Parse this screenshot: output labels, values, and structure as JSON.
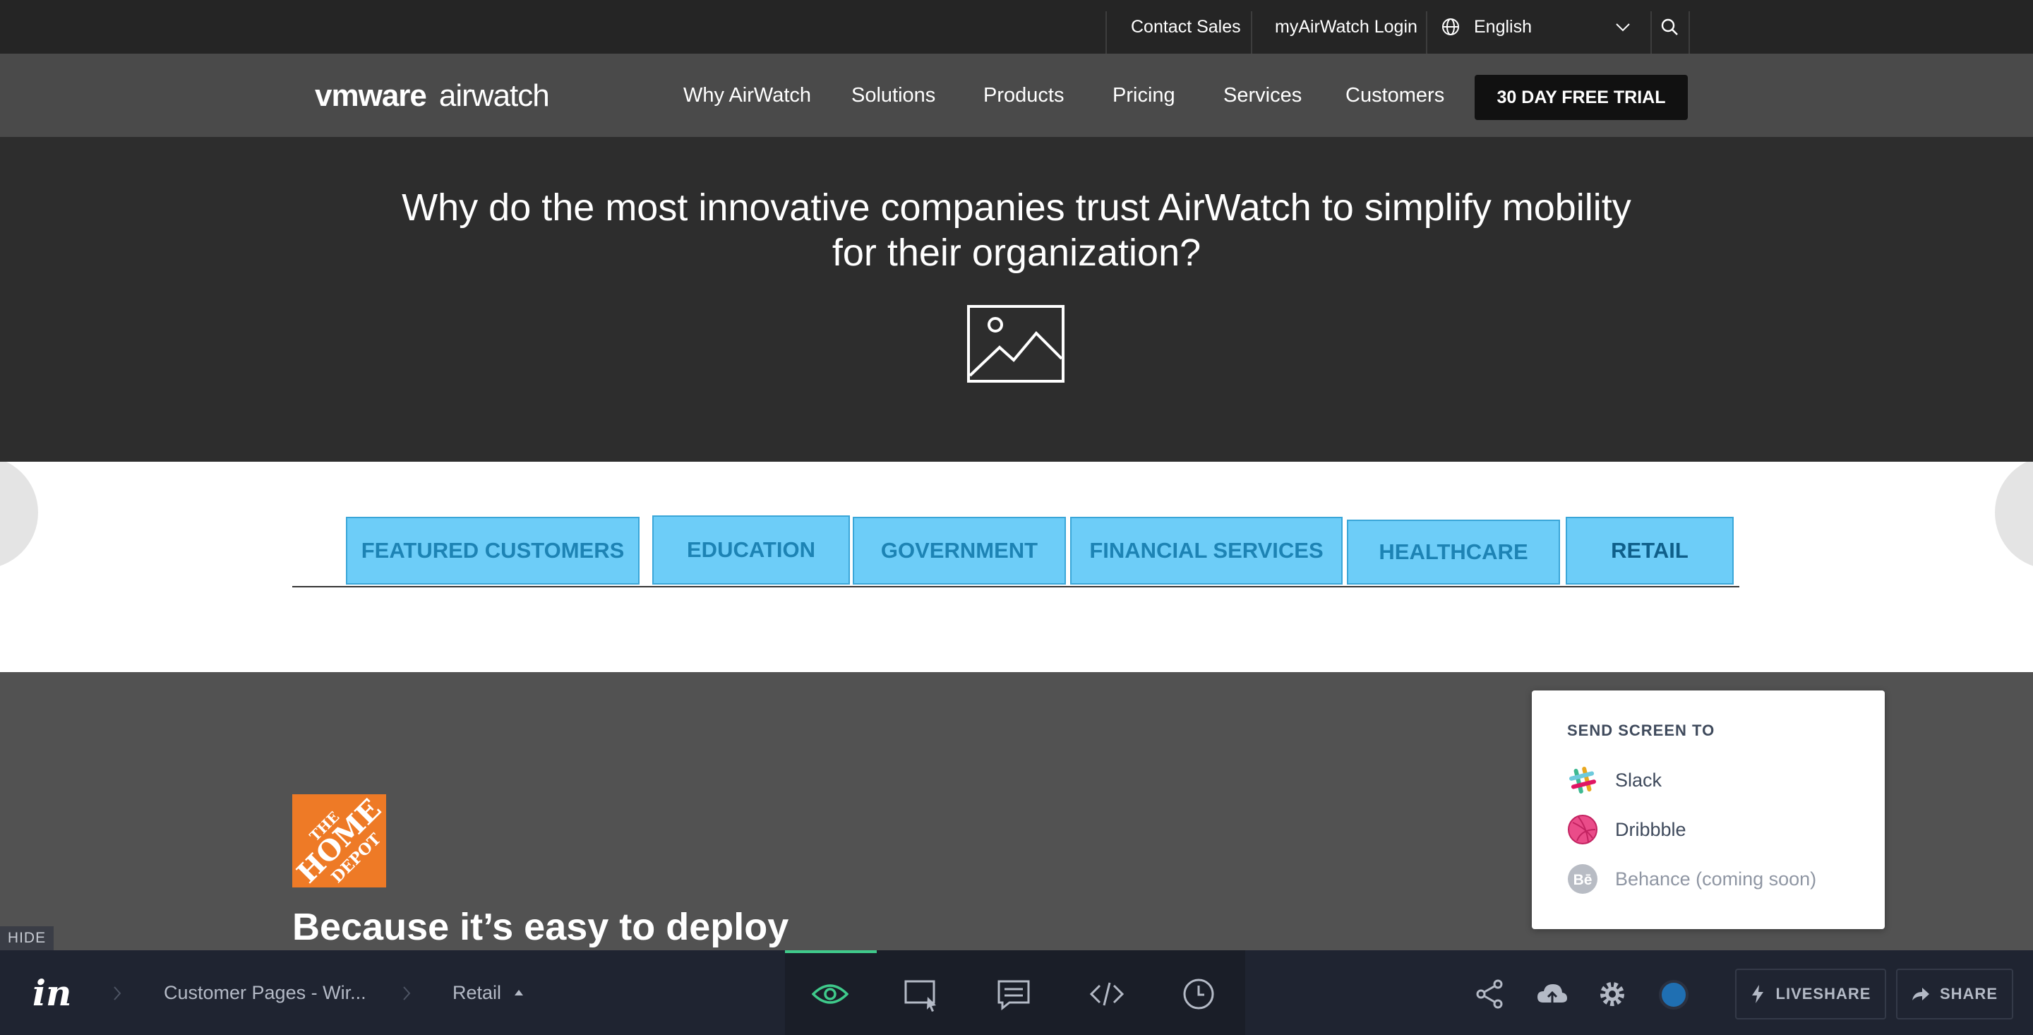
{
  "topbar": {
    "contact_sales": "Contact Sales",
    "login": "myAirWatch Login",
    "language": "English",
    "icons": [
      "globe-icon",
      "chevron-down-icon",
      "search-icon"
    ]
  },
  "navbar": {
    "logo_vm": "vmware",
    "logo_aw": "airwatch",
    "links": [
      "Why AirWatch",
      "Solutions",
      "Products",
      "Pricing",
      "Services",
      "Customers"
    ],
    "cta": "30 DAY FREE TRIAL"
  },
  "hero": {
    "title": "Why do the most innovative companies trust AirWatch to simplify mobility for their organization?",
    "image_icon": "image-placeholder-icon"
  },
  "tabs": [
    "FEATURED CUSTOMERS",
    "EDUCATION",
    "GOVERNMENT",
    "FINANCIAL SERVICES",
    "HEALTHCARE",
    "RETAIL"
  ],
  "customer": {
    "logo_text": "THE HOME DEPOT",
    "headline": "Because it’s easy to deploy"
  },
  "hide_label": "HIDE",
  "send_popup": {
    "title": "SEND SCREEN TO",
    "items": [
      "Slack",
      "Dribbble",
      "Behance (coming soon)"
    ]
  },
  "toolbar": {
    "project": "Customer Pages - Wir...",
    "screen": "Retail",
    "liveshare": "LIVESHARE",
    "share": "SHARE",
    "tools": [
      "preview-icon",
      "inspect-icon",
      "comment-icon",
      "code-icon",
      "history-icon"
    ]
  },
  "colors": {
    "tab_fill": "#6dcdf8",
    "tab_text": "#1d83b4",
    "hd_orange": "#ee7a26",
    "active_tool": "#3fca8b",
    "status_dot": "#1f6fb2"
  }
}
